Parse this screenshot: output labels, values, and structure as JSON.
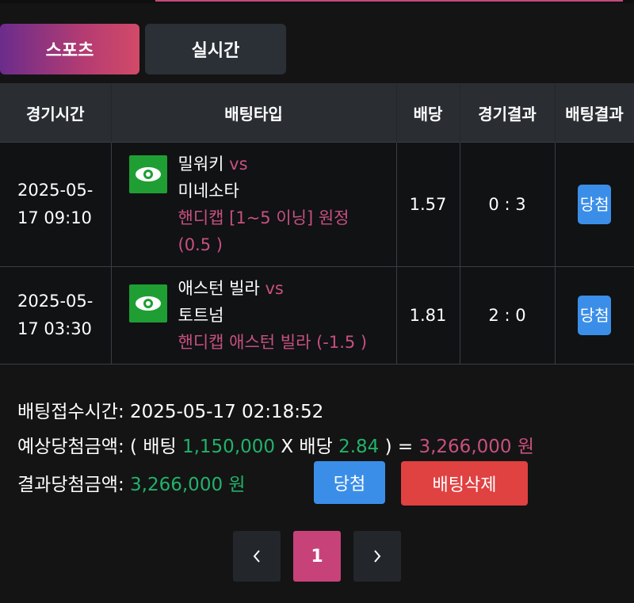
{
  "tabs": {
    "sports": "스포츠",
    "live": "실시간"
  },
  "table": {
    "headers": [
      "경기시간",
      "배팅타입",
      "배당",
      "경기결과",
      "배팅결과"
    ],
    "rows": [
      {
        "time_line1": "2025-05-",
        "time_line2": "17 09:10",
        "team_home": "밀워키",
        "vs": "vs",
        "team_away": "미네소타",
        "pick_line1": "핸디캡 [1~5 이닝] 원정",
        "pick_line2": "(0.5 )",
        "odds": "1.57",
        "score": "0 : 3",
        "result": "당첨"
      },
      {
        "time_line1": "2025-05-",
        "time_line2": "17 03:30",
        "team_home": "애스턴 빌라",
        "vs": "vs",
        "team_away": "토트넘",
        "pick_line1": "핸디캡 애스턴 빌라 (-1.5 )",
        "odds": "1.81",
        "score": "2 : 0",
        "result": "당첨"
      }
    ]
  },
  "summary": {
    "receipt_label": "배팅접수시간:",
    "receipt_time": "2025-05-17 02:18:52",
    "expected_label": "예상당첨금액:",
    "open_paren": "(",
    "bet_label": "배팅",
    "bet_amount": "1,150,000",
    "times": "X",
    "odds_label": "배당",
    "total_odds": "2.84",
    "close_eq": ") =",
    "expected_amount": "3,266,000 원",
    "result_label": "결과당첨금액:",
    "result_amount": "3,266,000 원"
  },
  "buttons": {
    "win": "당첨",
    "delete": "배팅삭제"
  },
  "pagination": {
    "current": "1"
  },
  "colors": {
    "accent": "#c8427a",
    "green": "#21b26b",
    "pink": "#c8507e",
    "blue": "#3b8ee8",
    "red": "#e04141"
  }
}
